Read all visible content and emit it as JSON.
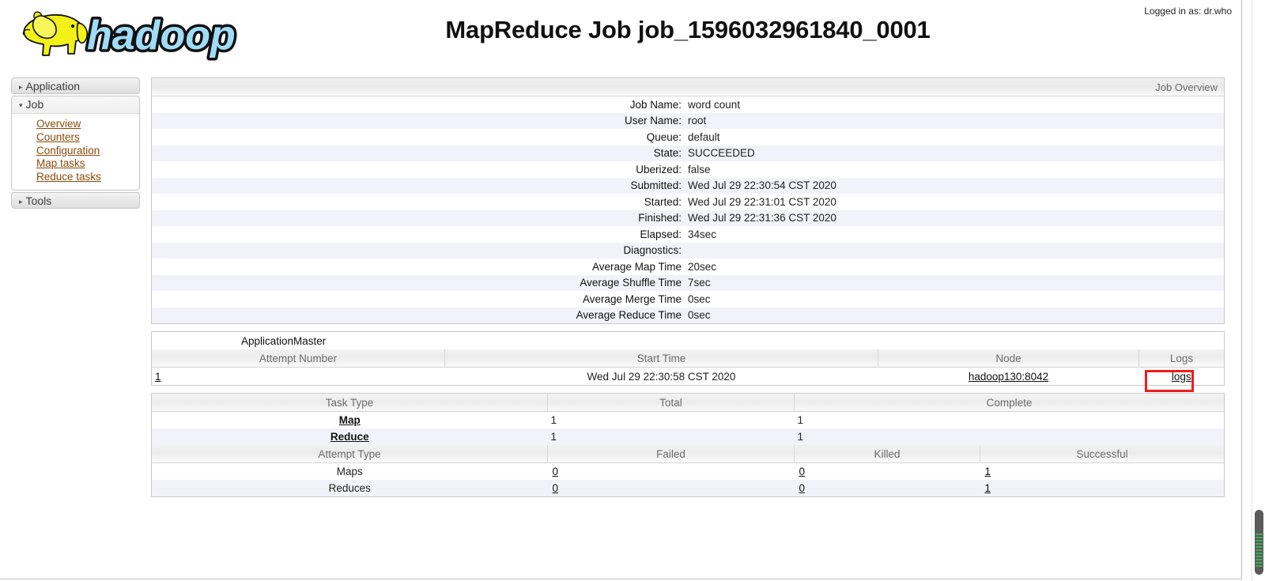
{
  "header": {
    "logo_alt": "hadoop",
    "title": "MapReduce Job job_1596032961840_0001",
    "logged_in": "Logged in as: dr.who"
  },
  "sidebar": {
    "application": {
      "label": "Application",
      "arrow": "▸"
    },
    "job": {
      "label": "Job",
      "arrow": "▾",
      "links": [
        "Overview",
        "Counters",
        "Configuration",
        "Map tasks",
        "Reduce tasks"
      ]
    },
    "tools": {
      "label": "Tools",
      "arrow": "▸"
    }
  },
  "job_overview": {
    "caption": "Job Overview",
    "rows": [
      {
        "label": "Job Name:",
        "value": "word count"
      },
      {
        "label": "User Name:",
        "value": "root"
      },
      {
        "label": "Queue:",
        "value": "default"
      },
      {
        "label": "State:",
        "value": "SUCCEEDED"
      },
      {
        "label": "Uberized:",
        "value": "false"
      },
      {
        "label": "Submitted:",
        "value": "Wed Jul 29 22:30:54 CST 2020"
      },
      {
        "label": "Started:",
        "value": "Wed Jul 29 22:31:01 CST 2020"
      },
      {
        "label": "Finished:",
        "value": "Wed Jul 29 22:31:36 CST 2020"
      },
      {
        "label": "Elapsed:",
        "value": "34sec"
      },
      {
        "label": "Diagnostics:",
        "value": ""
      },
      {
        "label": "Average Map Time",
        "value": "20sec"
      },
      {
        "label": "Average Shuffle Time",
        "value": "7sec"
      },
      {
        "label": "Average Merge Time",
        "value": "0sec"
      },
      {
        "label": "Average Reduce Time",
        "value": "0sec"
      }
    ]
  },
  "application_master": {
    "title": "ApplicationMaster",
    "headers": [
      "Attempt Number",
      "Start Time",
      "Node",
      "Logs"
    ],
    "row": {
      "attempt_number": "1",
      "start_time": "Wed Jul 29 22:30:58 CST 2020",
      "node": "hadoop130:8042",
      "logs": "logs"
    }
  },
  "task_summary": {
    "headers": [
      "Task Type",
      "Total",
      "Complete"
    ],
    "rows": [
      {
        "type": "Map",
        "total": "1",
        "complete": "1"
      },
      {
        "type": "Reduce",
        "total": "1",
        "complete": "1"
      }
    ]
  },
  "attempt_summary": {
    "headers": [
      "Attempt Type",
      "Failed",
      "Killed",
      "Successful"
    ],
    "rows": [
      {
        "type": "Maps",
        "failed": "0",
        "killed": "0",
        "successful": "1"
      },
      {
        "type": "Reduces",
        "failed": "0",
        "killed": "0",
        "successful": "1"
      }
    ]
  },
  "annotation": {
    "highlight_target": "logs",
    "highlight_color": "#ee1c1c"
  },
  "colors": {
    "link": "#8a4b08",
    "zebra_alt": "#f2f2fb",
    "header_gray": "#6b6b6b",
    "scroll_thumb": "#5a5a5a",
    "scroll_grip": "#3fa85a"
  }
}
